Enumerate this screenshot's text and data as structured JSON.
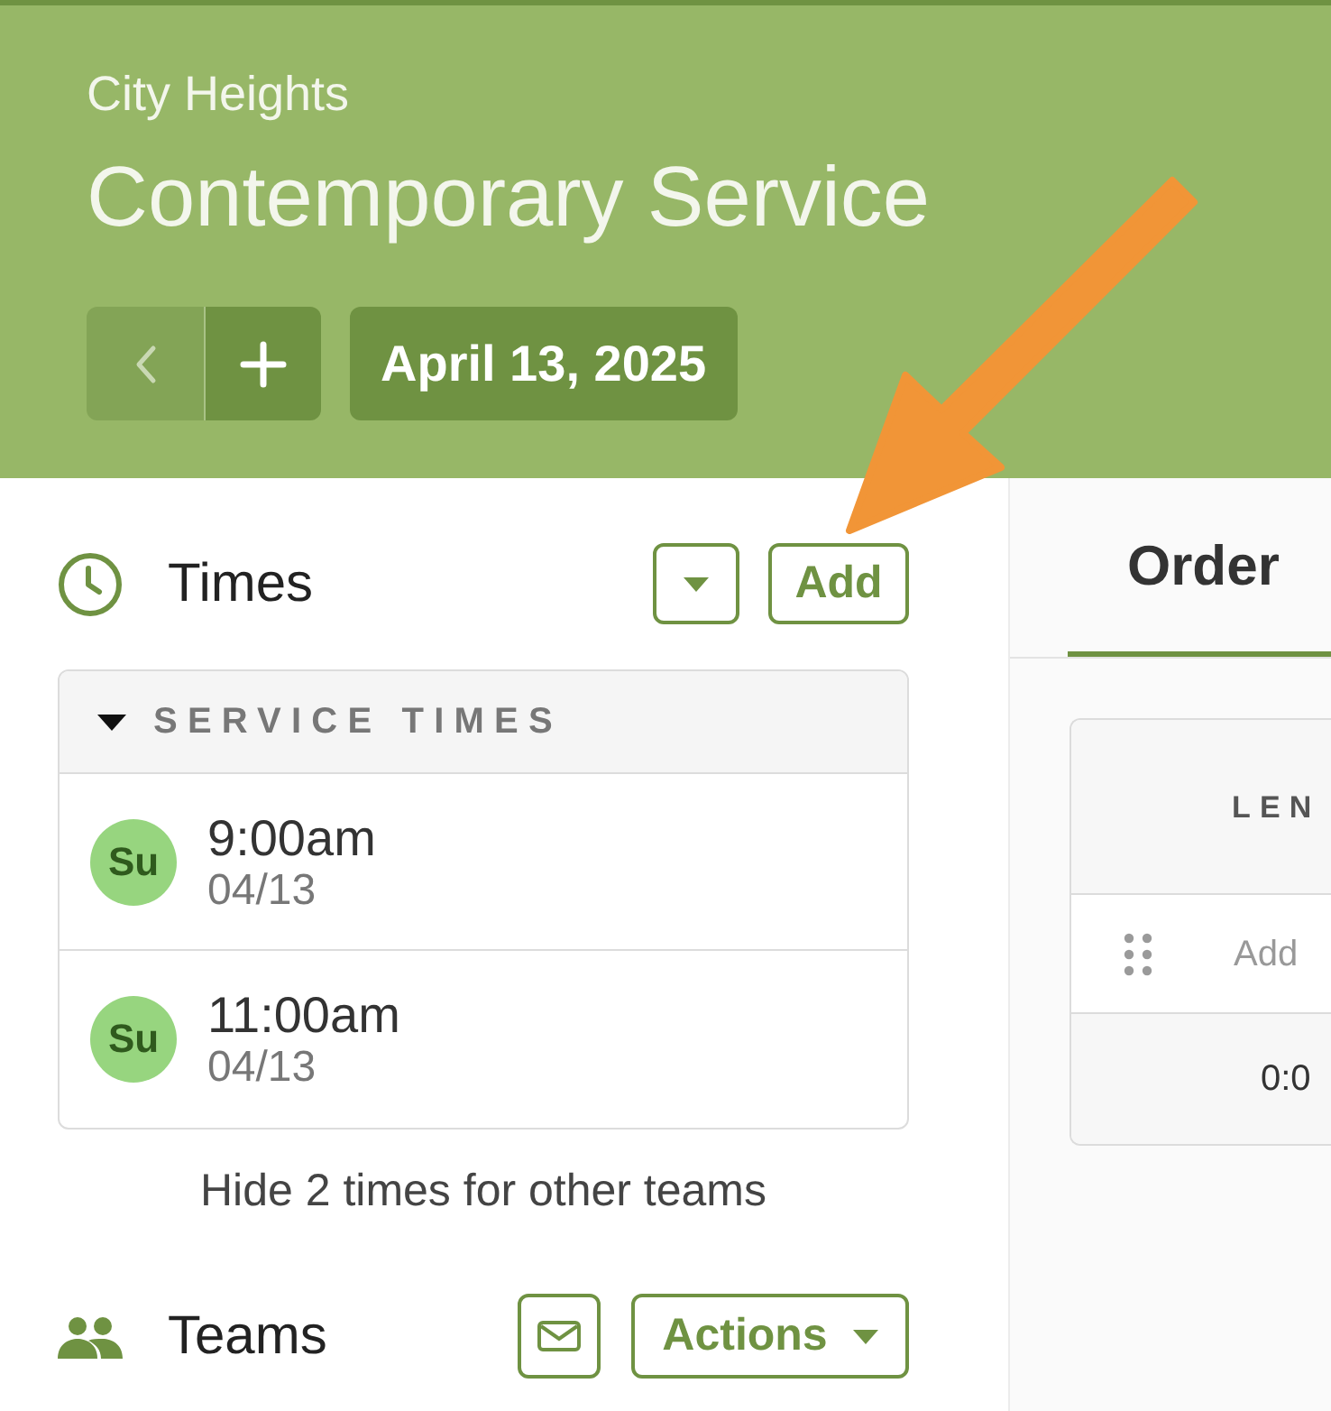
{
  "header": {
    "campus": "City Heights",
    "title": "Contemporary Service",
    "nav_buttons": [
      {
        "kind": "previous",
        "disabled": true
      },
      {
        "kind": "add",
        "disabled": false
      }
    ],
    "date_button": "April 13, 2025"
  },
  "times": {
    "title": "Times",
    "add_button": "Add",
    "group": {
      "title": "SERVICE TIMES",
      "expanded": true,
      "items": [
        {
          "day": "Su",
          "time": "9:00am",
          "date": "04/13"
        },
        {
          "day": "Su",
          "time": "11:00am",
          "date": "04/13"
        }
      ]
    },
    "hide_link": "Hide 2 times for other teams"
  },
  "teams": {
    "title": "Teams",
    "actions_button": "Actions"
  },
  "order": {
    "tabs": [
      {
        "label": "Order",
        "selected": true
      }
    ],
    "table": {
      "columns": [
        "LEN"
      ],
      "rows": [
        {
          "kind": "add",
          "text": "Add"
        },
        {
          "kind": "total",
          "text": "0:0"
        }
      ]
    }
  },
  "annotations": [
    {
      "kind": "arrow"
    }
  ]
}
